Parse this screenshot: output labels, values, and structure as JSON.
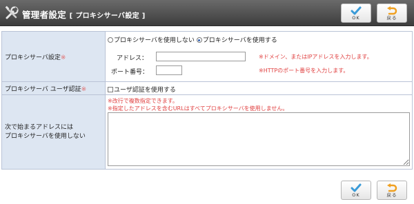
{
  "header": {
    "title": "管理者設定",
    "subtitle": "[ プロキシサーバ設定 ]",
    "ok_label": "OK",
    "back_label": "戻る"
  },
  "colors": {
    "ok_check": "#3a9bd8",
    "back_arrow": "#f0a020",
    "note_red": "#e04040"
  },
  "form": {
    "proxy": {
      "label": "プロキシサーバ設定",
      "req": "※",
      "option_off": "プロキシサーバを使用しない",
      "option_on": "プロキシサーバを使用する",
      "selected": "option_on",
      "address_label": "アドレス：",
      "address_value": "",
      "address_note": "※ドメイン、またはIPアドレスを入力します。",
      "port_label": "ポート番号：",
      "port_value": "",
      "port_note": "※HTTPのポート番号を入力します。"
    },
    "auth": {
      "label": "プロキシサーバ ユーザ認証",
      "req": "※",
      "checkbox_label": "ユーザ認証を使用する",
      "checked": false
    },
    "bypass": {
      "label_line1": "次で始まるアドレスには",
      "label_line2": "プロキシサーバを使用しない",
      "note1": "※改行で複数指定できます。",
      "note2": "※指定したアドレスを含むURLはすべてプロキシサーバを使用しません。",
      "value": ""
    }
  },
  "footer": {
    "ok_label": "OK",
    "back_label": "戻る"
  }
}
